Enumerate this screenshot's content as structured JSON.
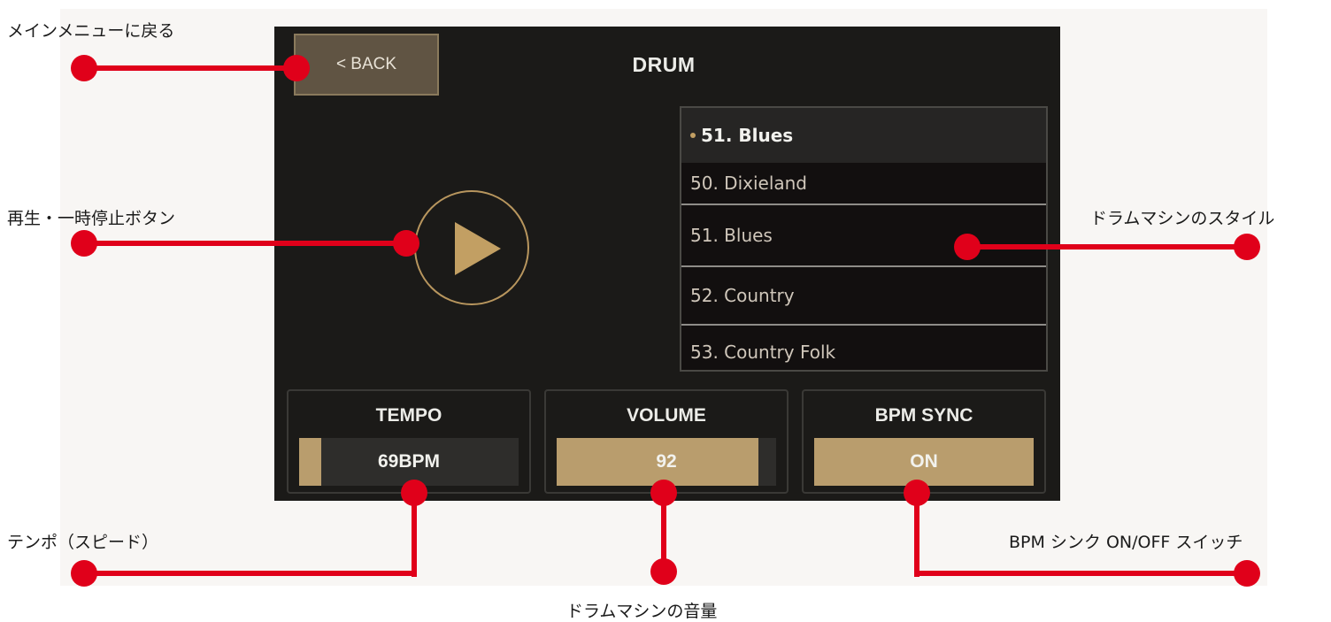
{
  "callouts": {
    "back": "メインメニューに戻る",
    "play": "再生・一時停止ボタン",
    "style": "ドラムマシンのスタイル",
    "tempo": "テンポ（スピード）",
    "volume": "ドラムマシンの音量",
    "bpm_sync": "BPM シンク ON/OFF スイッチ"
  },
  "screen": {
    "back_label": "< BACK",
    "title": "DRUM",
    "style_list": {
      "current": "51. Blues",
      "items": [
        "50. Dixieland",
        "51. Blues",
        "52. Country",
        "53. Country Folk"
      ]
    },
    "tempo": {
      "label": "TEMPO",
      "value": "69BPM",
      "level": 0.1
    },
    "volume": {
      "label": "VOLUME",
      "value": "92",
      "level": 0.92
    },
    "bpm_sync": {
      "label": "BPM SYNC",
      "value": "ON",
      "level": 1.0
    }
  },
  "colors": {
    "accent": "#c29f63",
    "callout": "#e0001a",
    "screen_bg": "#1b1a18"
  }
}
